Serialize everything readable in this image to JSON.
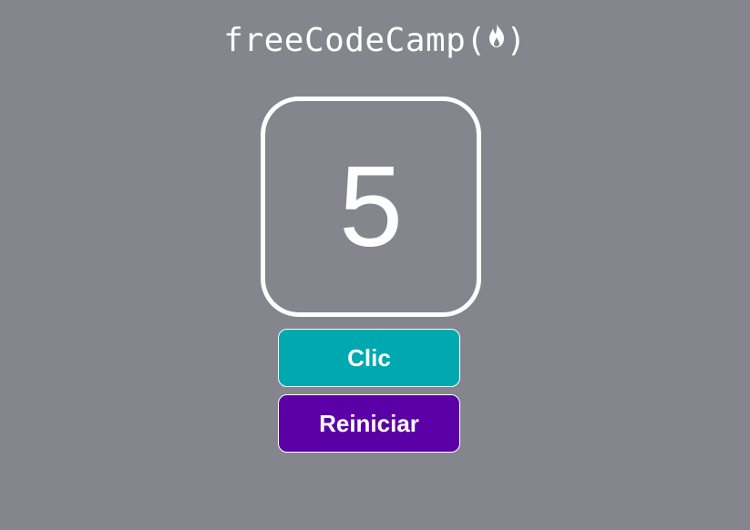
{
  "logo": {
    "text_left": "freeCodeCamp(",
    "text_right": ")",
    "icon": "fire-icon"
  },
  "counter": {
    "value": "5"
  },
  "buttons": {
    "click_label": "Clic",
    "reset_label": "Reiniciar"
  },
  "colors": {
    "background": "#85868d",
    "click_button": "#00a9b0",
    "reset_button": "#5a00a6",
    "foreground": "#ffffff"
  }
}
